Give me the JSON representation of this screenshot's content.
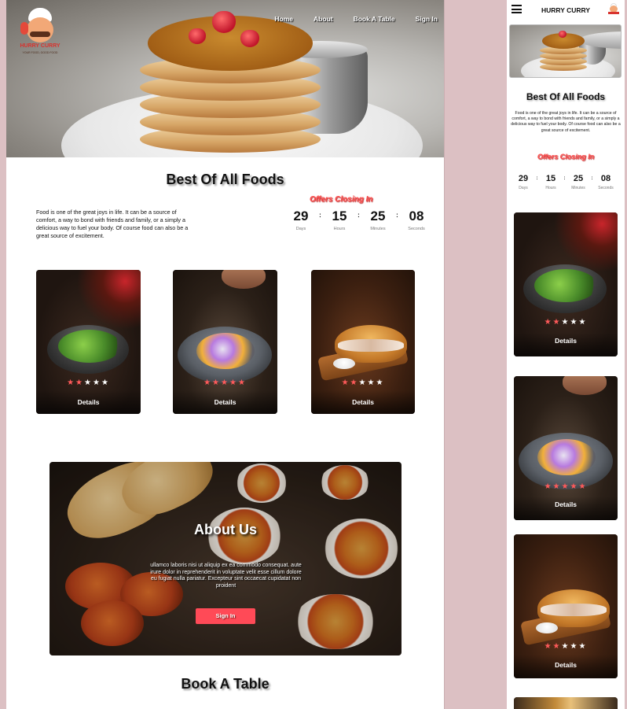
{
  "brand": {
    "logo_text": "HURRY CURRY",
    "logo_tagline": "YOUR FOOD, GOOD FOOD",
    "mobile_title": "HURRY CURRY"
  },
  "nav": {
    "items": [
      "Home",
      "About",
      "Book A Table",
      "Sign In"
    ]
  },
  "section_best": {
    "title": "Best Of All Foods",
    "intro": "Food is one of the great joys in life. It can be a source of comfort, a way to bond with friends and family, or a simply a delicious way to fuel your body. Of course food can also be a great source of excitement."
  },
  "offers": {
    "title": "Offers Closing In",
    "countdown": [
      {
        "value": "29",
        "label": "Days"
      },
      {
        "value": "15",
        "label": "Hours"
      },
      {
        "value": "25",
        "label": "Minutes"
      },
      {
        "value": "08",
        "label": "Seconds"
      }
    ],
    "separator": ":"
  },
  "cards": [
    {
      "image": "salad-bowl",
      "rating": 2,
      "max_rating": 5,
      "button": "Details"
    },
    {
      "image": "stone-bowl",
      "rating": 5,
      "max_rating": 5,
      "button": "Details"
    },
    {
      "image": "sandwich-board",
      "rating": 2,
      "max_rating": 5,
      "button": "Details"
    }
  ],
  "about": {
    "title": "About Us",
    "text": "ullamco laboris nisi ut aliquip ex ea commodo consequat. aute irure dolor in reprehenderit in voluptate velit esse cillum dolore eu fugiat nulla pariatur. Excepteur sint occaecat cupidatat non proident",
    "button": "Sign In"
  },
  "book": {
    "title": "Book A  Table"
  },
  "colors": {
    "accent": "#ff4a57",
    "star_active": "#ff5a5a",
    "offers_text": "#ff4b4b",
    "page_background": "#dcc0c3"
  },
  "icons": {
    "star": "star-icon",
    "menu": "hamburger-menu-icon"
  }
}
